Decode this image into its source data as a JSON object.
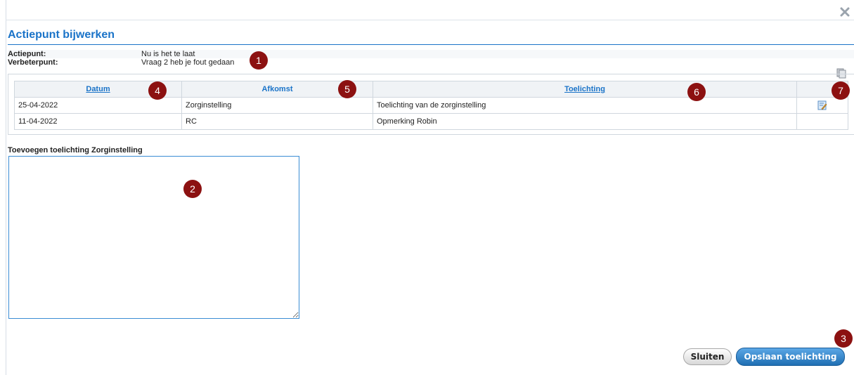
{
  "dialog": {
    "title": "Actiepunt bijwerken",
    "close_icon": "close-icon"
  },
  "info": {
    "actiepunt_label": "Actiepunt:",
    "actiepunt_value": "Nu is het te laat",
    "verbeterpunt_label": "Verbeterpunt:",
    "verbeterpunt_value": "Vraag 2 heb je fout gedaan"
  },
  "table": {
    "copy_icon": "copy-icon",
    "columns": [
      "Datum",
      "Afkomst",
      "Toelichting",
      ""
    ],
    "rows": [
      {
        "datum": "25-04-2022",
        "afkomst": "Zorginstelling",
        "toelichting": "Toelichting van de zorginstelling",
        "action_icon": "edit-icon"
      },
      {
        "datum": "11-04-2022",
        "afkomst": "RC",
        "toelichting": "Opmerking Robin",
        "action_icon": ""
      }
    ]
  },
  "form": {
    "label": "Toevoegen toelichting Zorginstelling",
    "value": ""
  },
  "buttons": {
    "close": "Sluiten",
    "save": "Opslaan toelichting"
  },
  "markers": [
    "1",
    "2",
    "3",
    "4",
    "5",
    "6",
    "7"
  ],
  "colors": {
    "accent": "#1a73c8",
    "marker": "#8c1111"
  }
}
